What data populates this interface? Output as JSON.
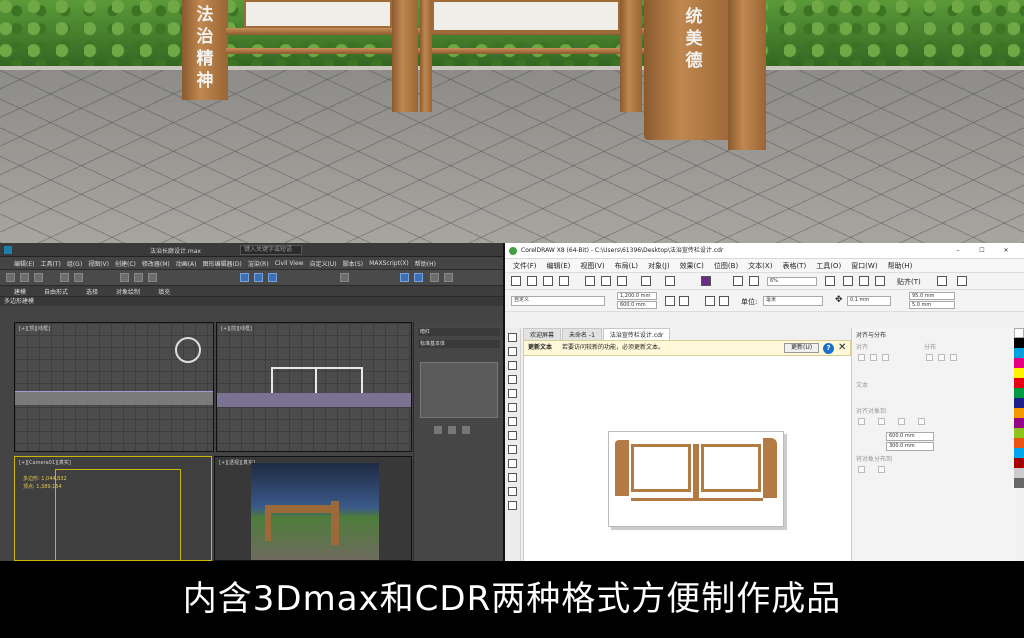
{
  "scene": {
    "left_post_text": "法治精神",
    "right_post_text": "统美德"
  },
  "max": {
    "window_title": "法治长廊设计.max",
    "search_placeholder": "键入关键字或短语",
    "menu": [
      "编辑(E)",
      "工具(T)",
      "组(G)",
      "视图(V)",
      "创建(C)",
      "修改器(M)",
      "动画(A)",
      "图形编辑器(D)",
      "渲染(R)",
      "Civil View",
      "自定义(U)",
      "脚本(S)",
      "MAXScript(X)",
      "帮助(H)"
    ],
    "ribbon": [
      "建模",
      "自由形式",
      "选择",
      "对象绘制",
      "填充"
    ],
    "subribbon": "多边形建模",
    "viewports": [
      {
        "label": "[+][顶][线框]"
      },
      {
        "label": "[+][前][线框]"
      },
      {
        "label": "[+][Camera01][真实]"
      },
      {
        "label": "[+][透视][真实]"
      }
    ],
    "cam_info": [
      "多边形: 1,044,832",
      "顶点: 1,389,154"
    ],
    "cmd_field": "暗红",
    "cmd_field2": "标准基本体"
  },
  "cdr": {
    "window_title": "CorelDRAW X8 (64-Bit) - C:\\Users\\61396\\Desktop\\法治宣传栏设计.cdr",
    "menu": [
      "文件(F)",
      "编辑(E)",
      "视图(V)",
      "布局(L)",
      "对象(J)",
      "效果(C)",
      "位图(B)",
      "文本(X)",
      "表格(T)",
      "工具(O)",
      "窗口(W)",
      "帮助(H)"
    ],
    "zoom": "6%",
    "snap": "贴齐(T)",
    "preset": "自定义",
    "width": "1,200.0 mm",
    "height": "600.0 mm",
    "units_label": "单位:",
    "units": "毫米",
    "nudge": "0.1 mm",
    "dup_x": "95.0 mm",
    "dup_y": "5.0 mm",
    "tabs": [
      "欢迎屏幕",
      "未命名 -1",
      "法治宣传栏设计.cdr"
    ],
    "notice_label": "更新文本",
    "notice_text": "若要访问较新的功能，必须更新文本。",
    "update_button": "更新(U)",
    "docker_title": "对齐与分布",
    "docker_rows": [
      "对齐",
      "分布",
      "文本",
      "对齐对象到",
      "将对象分布到"
    ],
    "docker_x": "600.0 mm",
    "docker_y": "300.0 mm"
  },
  "caption": "内含3Dmax和CDR两种格式方便制作成品",
  "colors": {
    "wood": "#b37a44",
    "hedge": "#4f8e33",
    "max_bg": "#444444",
    "cdr_bg": "#f0f0f0",
    "caption_bg": "#000000"
  }
}
